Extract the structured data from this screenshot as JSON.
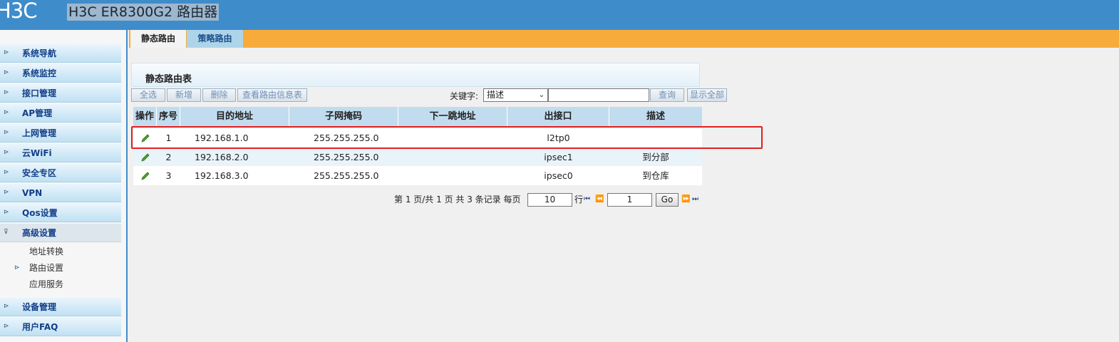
{
  "header": {
    "logo": "H3C",
    "model": "H3C ER8300G2 路由器"
  },
  "sidebar": {
    "items": [
      {
        "label": "系统导航"
      },
      {
        "label": "系统监控"
      },
      {
        "label": "接口管理"
      },
      {
        "label": "AP管理"
      },
      {
        "label": "上网管理"
      },
      {
        "label": "云WiFi"
      },
      {
        "label": "安全专区"
      },
      {
        "label": "VPN"
      },
      {
        "label": "Qos设置"
      },
      {
        "label": "高级设置"
      },
      {
        "label": "设备管理"
      },
      {
        "label": "用户FAQ"
      }
    ],
    "sub_items": [
      {
        "label": "地址转换"
      },
      {
        "label": "路由设置"
      },
      {
        "label": "应用服务"
      }
    ]
  },
  "tabs": {
    "static": "静态路由",
    "policy": "策略路由"
  },
  "panel": {
    "title": "静态路由表"
  },
  "toolbar": {
    "select_all": "全选",
    "add": "新增",
    "delete": "删除",
    "view_routes": "查看路由信息表",
    "keyword_label": "关键字:",
    "keyword_value": "描述",
    "search": "查询",
    "show_all": "显示全部"
  },
  "table": {
    "headers": [
      "操作",
      "序号",
      "目的地址",
      "子网掩码",
      "下一跳地址",
      "出接口",
      "描述"
    ],
    "rows": [
      {
        "no": "1",
        "dest": "192.168.1.0",
        "mask": "255.255.255.0",
        "next_hop": "",
        "iface": "l2tp0",
        "desc": ""
      },
      {
        "no": "2",
        "dest": "192.168.2.0",
        "mask": "255.255.255.0",
        "next_hop": "",
        "iface": "ipsec1",
        "desc": "到分部"
      },
      {
        "no": "3",
        "dest": "192.168.3.0",
        "mask": "255.255.255.0",
        "next_hop": "",
        "iface": "ipsec0",
        "desc": "到仓库"
      }
    ]
  },
  "pager": {
    "summary": "第 1 页/共 1 页 共 3 条记录 每页",
    "per_page": "10",
    "rows_unit": "行",
    "page": "1",
    "go": "Go"
  },
  "colors": {
    "header": "#3f8ccb",
    "tabbar": "#f6ab3b",
    "highlight": "#e02020"
  }
}
